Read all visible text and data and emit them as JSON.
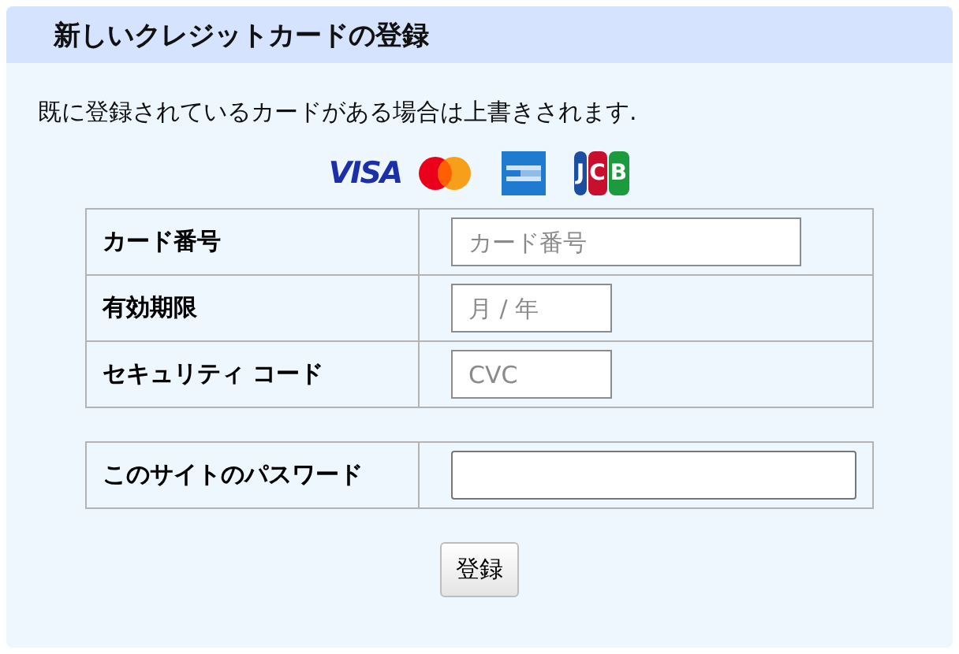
{
  "panel": {
    "title": "新しいクレジットカードの登録"
  },
  "notice": "既に登録されているカードがある場合は上書きされます.",
  "card_logos": [
    {
      "kind": "visa",
      "text": "VISA"
    },
    {
      "kind": "mastercard"
    },
    {
      "kind": "amex"
    },
    {
      "kind": "jcb",
      "text": "JCB"
    }
  ],
  "card_fields": [
    {
      "label": "カード番号",
      "placeholder": "カード番号",
      "kind": "wide"
    },
    {
      "label": "有効期限",
      "placeholder": "月 / 年",
      "kind": "narrow"
    },
    {
      "label": "セキュリティ コード",
      "placeholder": "CVC",
      "kind": "narrow"
    }
  ],
  "password_fields": [
    {
      "label": "このサイトのパスワード",
      "kind": "password"
    }
  ],
  "submit_button": "登録"
}
